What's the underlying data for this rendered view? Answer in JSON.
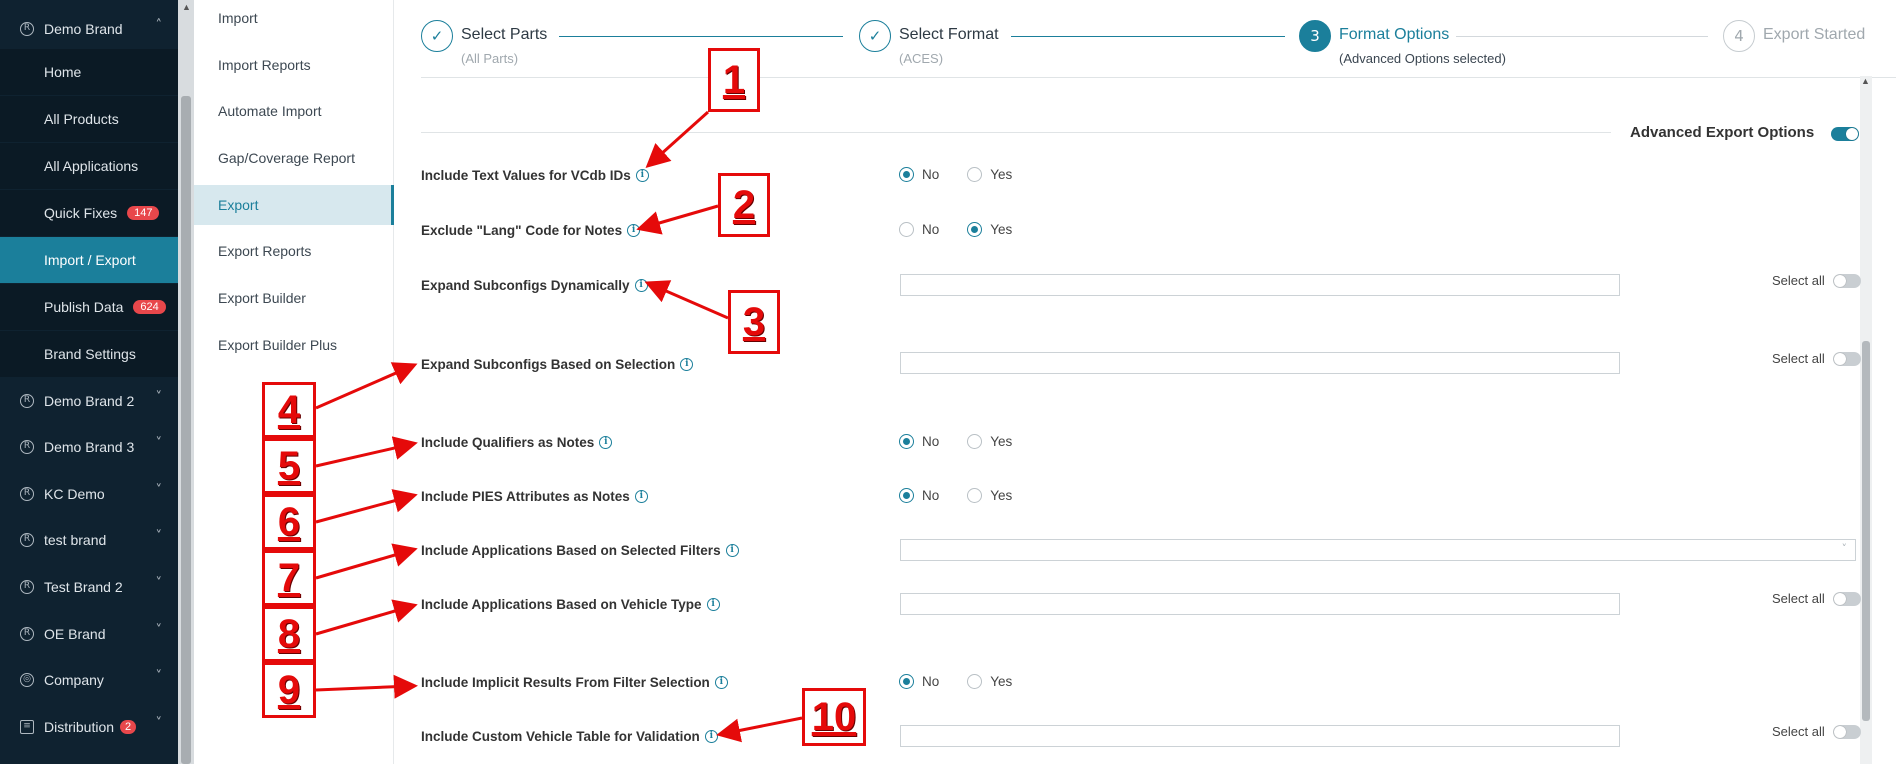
{
  "sidebar": {
    "top_brand": "Demo Brand",
    "sub_items": [
      {
        "label": "Home"
      },
      {
        "label": "All Products"
      },
      {
        "label": "All Applications"
      },
      {
        "label": "Quick Fixes",
        "badge": "147"
      },
      {
        "label": "Import / Export",
        "active": true
      },
      {
        "label": "Publish Data",
        "badge": "624"
      },
      {
        "label": "Brand Settings"
      }
    ],
    "brands": [
      {
        "label": "Demo Brand 2"
      },
      {
        "label": "Demo Brand 3"
      },
      {
        "label": "KC Demo"
      },
      {
        "label": "test brand"
      },
      {
        "label": "Test Brand 2"
      },
      {
        "label": "OE Brand"
      },
      {
        "label": "Company"
      },
      {
        "label": "Distribution",
        "badge": "2"
      }
    ]
  },
  "subnav": {
    "items": [
      "Import",
      "Import Reports",
      "Automate Import",
      "Gap/Coverage Report",
      "Export",
      "Export Reports",
      "Export Builder",
      "Export Builder Plus"
    ],
    "active": "Export"
  },
  "stepper": {
    "steps": [
      {
        "label": "Select Parts",
        "sub": "(All Parts)",
        "state": "done"
      },
      {
        "label": "Select Format",
        "sub": "(ACES)",
        "state": "done"
      },
      {
        "label": "Format Options",
        "sub": "(Advanced Options selected)",
        "number": "3",
        "state": "current"
      },
      {
        "label": "Export Started",
        "number": "4",
        "state": "pending"
      }
    ]
  },
  "advanced": {
    "label": "Advanced Export Options",
    "enabled": true
  },
  "options": {
    "yes": "Yes",
    "no": "No",
    "select_all": "Select all",
    "rows": [
      {
        "label": "Include Text Values for VCdb IDs",
        "type": "radio",
        "value": "No"
      },
      {
        "label": "Exclude \"Lang\" Code for Notes",
        "type": "radio",
        "value": "Yes"
      },
      {
        "label": "Expand Subconfigs Dynamically",
        "type": "input",
        "value": ""
      },
      {
        "label": "Expand Subconfigs Based on Selection",
        "type": "input",
        "value": ""
      },
      {
        "label": "Include Qualifiers as Notes",
        "type": "radio",
        "value": "No"
      },
      {
        "label": "Include PIES Attributes as Notes",
        "type": "radio",
        "value": "No"
      },
      {
        "label": "Include Applications Based on Selected Filters",
        "type": "select",
        "value": ""
      },
      {
        "label": "Include Applications Based on Vehicle Type",
        "type": "input",
        "value": ""
      },
      {
        "label": "Include Implicit Results From Filter Selection",
        "type": "radio",
        "value": "No"
      },
      {
        "label": "Include Custom Vehicle Table for Validation",
        "type": "input",
        "value": ""
      }
    ]
  },
  "annotations": [
    "1",
    "2",
    "3",
    "4",
    "5",
    "6",
    "7",
    "8",
    "9",
    "10"
  ],
  "colors": {
    "accent": "#1b7f9b",
    "sidebar": "#0f2230",
    "annotation": "#e50a0a",
    "badge": "#e8474b"
  }
}
